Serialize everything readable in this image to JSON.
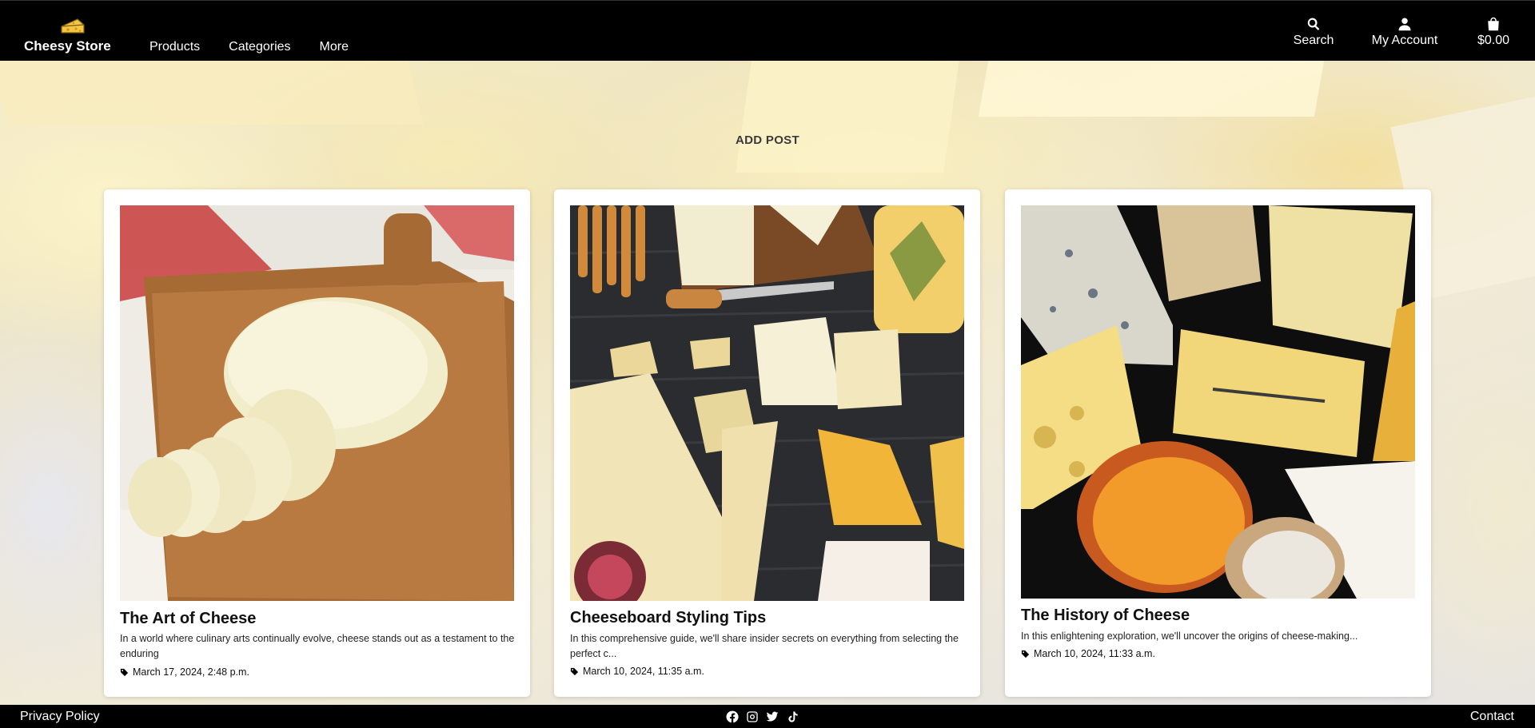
{
  "header": {
    "brand": "Cheesy Store",
    "logo_icon": "cheese-icon",
    "nav": [
      "Products",
      "Categories",
      "More"
    ],
    "search_label": "Search",
    "account_label": "My Account",
    "cart_total": "$0.00",
    "icons": {
      "search": "search-icon",
      "account": "user-icon",
      "cart": "shopping-bag-icon"
    }
  },
  "main": {
    "add_post_label": "ADD POST",
    "posts": [
      {
        "title": "The Art of Cheese",
        "excerpt": "In a world where culinary arts continually evolve, cheese stands out as a testament to the enduring",
        "date": "March 17, 2024, 2:48 p.m.",
        "image": "sliced mozzarella on wooden board"
      },
      {
        "title": "Cheeseboard Styling Tips",
        "excerpt": "In this comprehensive guide, we'll share insider secrets on everything from selecting the perfect c...",
        "date": "March 10, 2024, 11:35 a.m.",
        "image": "cheese assortment on dark wood"
      },
      {
        "title": "The History of Cheese",
        "excerpt": "In this enlightening exploration, we'll uncover the origins of cheese-making...",
        "date": "March 10, 2024, 11:33 a.m.",
        "image": "variety of cheese wedges on black"
      }
    ]
  },
  "footer": {
    "privacy_label": "Privacy Policy",
    "contact_label": "Contact",
    "social_icons": [
      "facebook-icon",
      "instagram-icon",
      "twitter-icon",
      "tiktok-icon"
    ]
  },
  "colors": {
    "header_bg": "#000000",
    "card_bg": "#ffffff",
    "accent_text": "#3a3a3a"
  }
}
